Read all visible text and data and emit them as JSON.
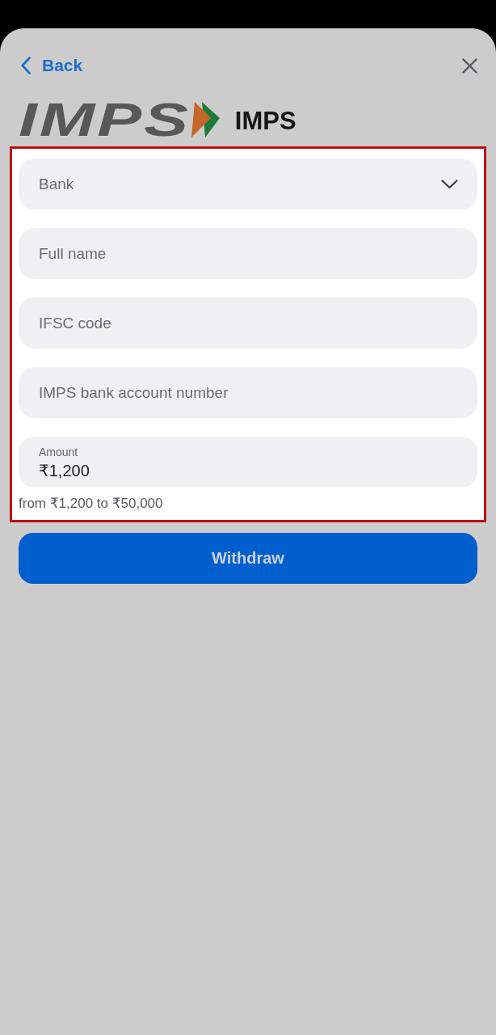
{
  "header": {
    "back_label": "Back"
  },
  "logo": {
    "wordmark": "IMPS",
    "title": "IMPS"
  },
  "form": {
    "highlighted": true,
    "fields": [
      {
        "kind": "select",
        "placeholder": "Bank"
      },
      {
        "kind": "text",
        "placeholder": "Full name"
      },
      {
        "kind": "text",
        "placeholder": "IFSC code"
      },
      {
        "kind": "text",
        "placeholder": "IMPS bank account number"
      },
      {
        "kind": "amount",
        "label": "Amount",
        "value": "₹1,200"
      }
    ],
    "hint": "from ₹1,200 to ₹50,000"
  },
  "submit_button": {
    "label": "Withdraw"
  }
}
